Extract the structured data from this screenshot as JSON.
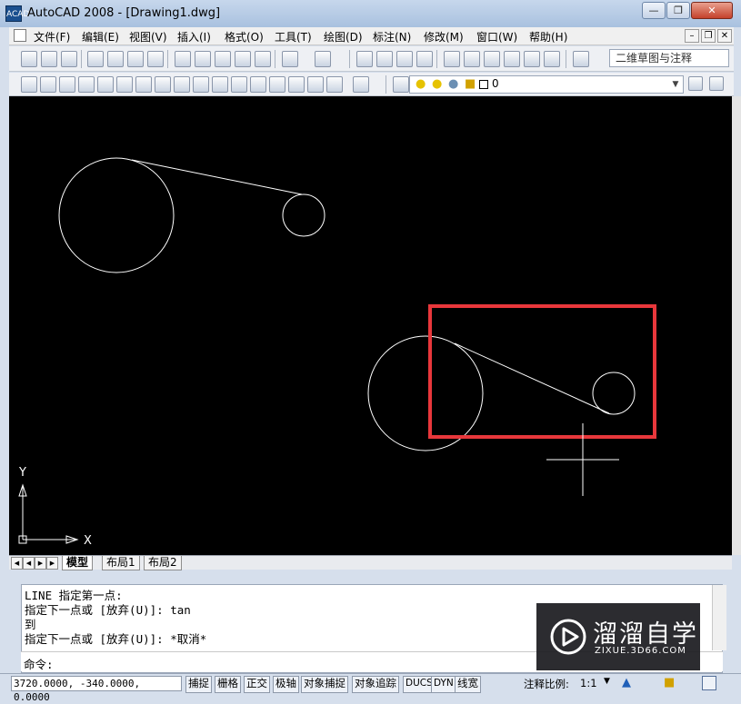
{
  "window": {
    "title": "AutoCAD 2008 - [Drawing1.dwg]",
    "app_icon_label": "ACAD"
  },
  "menu": {
    "items": [
      "文件(F)",
      "编辑(E)",
      "视图(V)",
      "插入(I)",
      "格式(O)",
      "工具(T)",
      "绘图(D)",
      "标注(N)",
      "修改(M)",
      "窗口(W)",
      "帮助(H)"
    ]
  },
  "toolbar": {
    "workspace": "二维草图与注释",
    "layer_value": "0"
  },
  "canvas": {
    "ucs_y": "Y",
    "ucs_x": "X",
    "highlight_color": "#e8373b"
  },
  "tabs": {
    "items": [
      "模型",
      "布局1",
      "布局2"
    ]
  },
  "command": {
    "history": [
      "LINE 指定第一点:",
      "指定下一点或 [放弃(U)]: tan",
      "到",
      "指定下一点或 [放弃(U)]: *取消*"
    ],
    "prompt": "命令:"
  },
  "watermark": {
    "name": "溜溜自学",
    "url": "ZIXUE.3D66.COM"
  },
  "status": {
    "coords": "3720.0000, -340.0000, 0.0000",
    "buttons": [
      "捕捉",
      "栅格",
      "正交",
      "极轴",
      "对象捕捉",
      "对象追踪",
      "DUCS",
      "DYN",
      "线宽"
    ],
    "annotation_scale_label": "注释比例:",
    "annotation_scale_value": "1:1"
  }
}
